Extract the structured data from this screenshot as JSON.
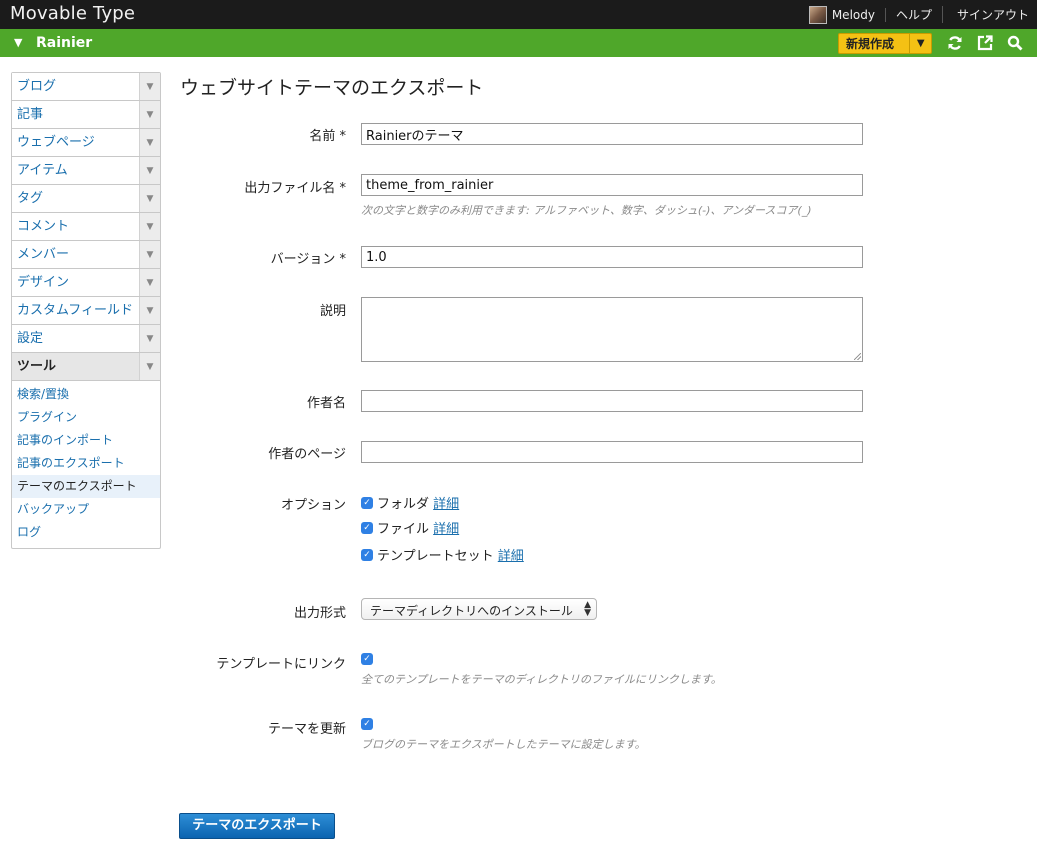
{
  "app": {
    "logo": "Movable Type"
  },
  "topnav": {
    "user": "Melody",
    "help": "ヘルプ",
    "signout": "サインアウト"
  },
  "sitebar": {
    "site_name": "Rainier",
    "new_button": "新規作成"
  },
  "sidebar": {
    "items": [
      {
        "label": "ブログ"
      },
      {
        "label": "記事"
      },
      {
        "label": "ウェブページ"
      },
      {
        "label": "アイテム"
      },
      {
        "label": "タグ"
      },
      {
        "label": "コメント"
      },
      {
        "label": "メンバー"
      },
      {
        "label": "デザイン"
      },
      {
        "label": "カスタムフィールド"
      },
      {
        "label": "設定"
      },
      {
        "label": "ツール"
      }
    ],
    "subitems": [
      {
        "label": "検索/置換"
      },
      {
        "label": "プラグイン"
      },
      {
        "label": "記事のインポート"
      },
      {
        "label": "記事のエクスポート"
      },
      {
        "label": "テーマのエクスポート"
      },
      {
        "label": "バックアップ"
      },
      {
        "label": "ログ"
      }
    ]
  },
  "page": {
    "title": "ウェブサイトテーマのエクスポート"
  },
  "form": {
    "name": {
      "label": "名前 *",
      "value": "Rainierのテーマ"
    },
    "filename": {
      "label": "出力ファイル名 *",
      "value": "theme_from_rainier",
      "hint": "次の文字と数字のみ利用できます: アルファベット、数字、ダッシュ(-)、アンダースコア(_)"
    },
    "version": {
      "label": "バージョン *",
      "value": "1.0"
    },
    "description": {
      "label": "説明",
      "value": ""
    },
    "author": {
      "label": "作者名",
      "value": ""
    },
    "author_page": {
      "label": "作者のページ",
      "value": ""
    },
    "options": {
      "label": "オプション",
      "items": [
        {
          "label": "フォルダ",
          "link": "詳細",
          "checked": true
        },
        {
          "label": "ファイル",
          "link": "詳細",
          "checked": true
        },
        {
          "label": "テンプレートセット",
          "link": "詳細",
          "checked": true
        }
      ]
    },
    "output_format": {
      "label": "出力形式",
      "selected": "テーマディレクトリへのインストール"
    },
    "link_templates": {
      "label": "テンプレートにリンク",
      "hint": "全てのテンプレートをテーマのディレクトリのファイルにリンクします。",
      "checked": true
    },
    "update_theme": {
      "label": "テーマを更新",
      "hint": "ブログのテーマをエクスポートしたテーマに設定します。",
      "checked": true
    },
    "submit": "テーマのエクスポート"
  }
}
